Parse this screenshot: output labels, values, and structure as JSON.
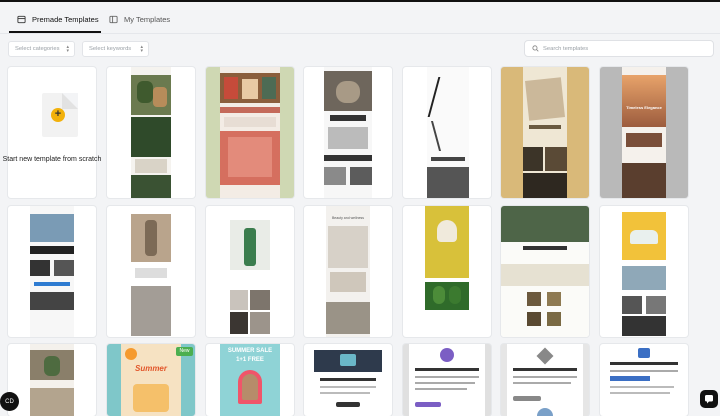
{
  "tabs": {
    "premade_label": "Premade Templates",
    "my_label": "My Templates"
  },
  "filters": {
    "categories_placeholder": "Select categories",
    "keywords_placeholder": "Select keywords",
    "search_placeholder": "Search templates"
  },
  "new_template": {
    "label": "Start new template from scratch"
  },
  "badges": {
    "new": "New"
  },
  "thumb_text": {
    "summer": "Summer",
    "summer_sale": "SUMMER SALE",
    "one_plus_one": "1+1 FREE",
    "timeless": "Timeless Elegance",
    "beauty": "Beauty and wellness",
    "logo": "LOGO"
  },
  "corner_button": "CD",
  "colors": {
    "accent": "#f2b10b",
    "badge": "#4caf50"
  }
}
